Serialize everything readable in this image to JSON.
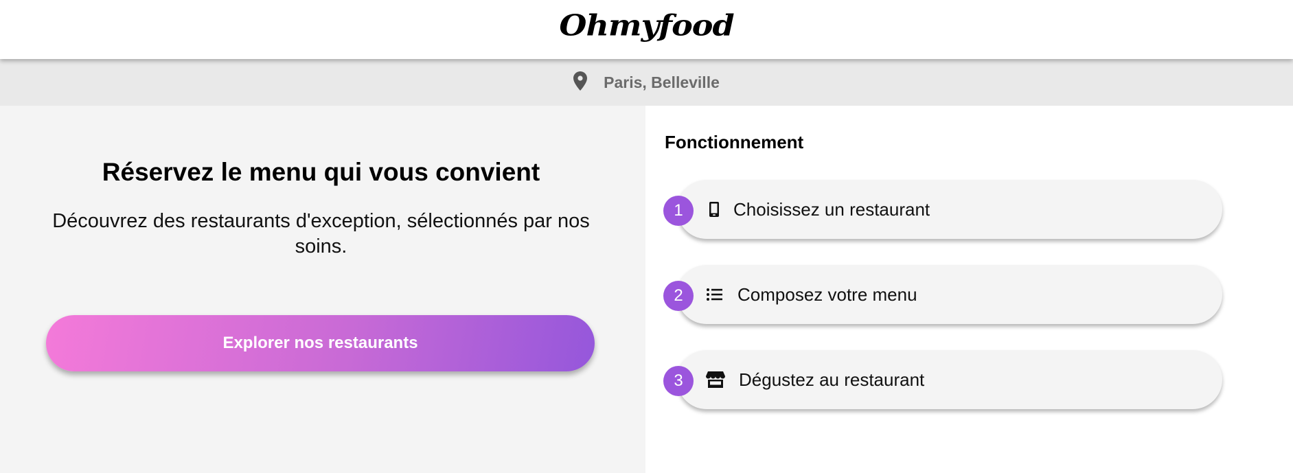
{
  "header": {
    "logo": "Ohmyfood"
  },
  "location": {
    "icon": "map-pin-icon",
    "text": "Paris, Belleville"
  },
  "hero": {
    "title": "Réservez le menu qui vous convient",
    "subtitle": "Découvrez des restaurants d'exception, sélectionnés par nos soins.",
    "cta_label": "Explorer nos restaurants"
  },
  "how_it_works": {
    "title": "Fonctionnement",
    "steps": [
      {
        "number": "1",
        "icon": "mobile-phone-icon",
        "label": "Choisissez un restaurant"
      },
      {
        "number": "2",
        "icon": "list-icon",
        "label": "Composez votre menu"
      },
      {
        "number": "3",
        "icon": "store-icon",
        "label": "Dégustez au restaurant"
      }
    ]
  },
  "colors": {
    "accent_purple": "#9b55dd",
    "gradient_start": "#f47ad9",
    "gradient_end": "#9557db",
    "light_gray": "#f4f4f4",
    "location_bar": "#e9e9e9"
  }
}
